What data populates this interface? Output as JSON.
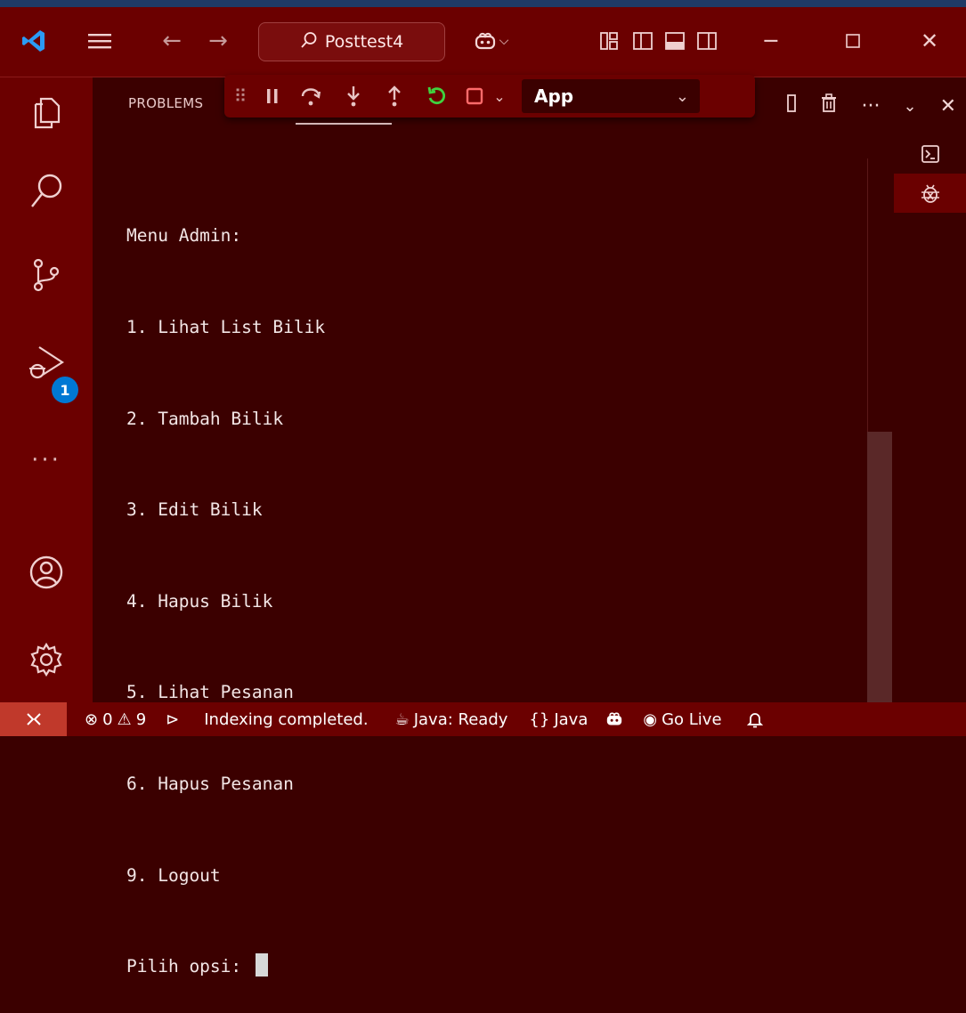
{
  "title_bar": {
    "search_label": "Posttest4",
    "icons": {
      "app": "vscode-logo",
      "menu": "hamburger-menu-icon",
      "back": "arrow-left-icon",
      "forward": "arrow-right-icon",
      "search": "search-icon",
      "copilot": "copilot-icon",
      "layout": [
        "customize-layout-icon",
        "toggle-primary-sidebar-icon",
        "toggle-panel-icon",
        "toggle-secondary-sidebar-icon"
      ],
      "window": [
        "minimize-icon",
        "maximize-icon",
        "close-icon"
      ]
    }
  },
  "activity_bar": {
    "items": [
      "explorer-icon",
      "search-icon",
      "source-control-icon",
      "run-and-debug-icon",
      "more-icon",
      "accounts-icon",
      "manage-gear-icon"
    ],
    "debug_badge": "1"
  },
  "panel": {
    "active_tab": "PROBLEMS",
    "actions": [
      "split-icon",
      "trash-icon",
      "ellipsis-icon",
      "chevron-down-icon",
      "close-icon"
    ]
  },
  "debug_toolbar": {
    "buttons": [
      "drag-handle-icon",
      "pause-icon",
      "step-over-icon",
      "step-into-icon",
      "step-out-icon",
      "restart-icon",
      "stop-icon",
      "chevron-down-icon"
    ],
    "config": "App"
  },
  "terminal": {
    "lines": [
      "Menu Admin:",
      "1. Lihat List Bilik",
      "2. Tambah Bilik",
      "3. Edit Bilik",
      "4. Hapus Bilik",
      "5. Lihat Pesanan",
      "6. Hapus Pesanan",
      "9. Logout"
    ],
    "prompt": "Pilih opsi: "
  },
  "side_tabs": [
    "terminal-icon",
    "debug-console-icon"
  ],
  "status_bar": {
    "errors": "0",
    "warnings": "9",
    "indexing": "Indexing completed.",
    "java_status": "Java: Ready",
    "language": "Java",
    "go_live": "Go Live"
  },
  "colors": {
    "titlebar": "#6b0000",
    "panel": "#3b0000",
    "badge": "#0078d4",
    "restart": "#3fd23f"
  }
}
